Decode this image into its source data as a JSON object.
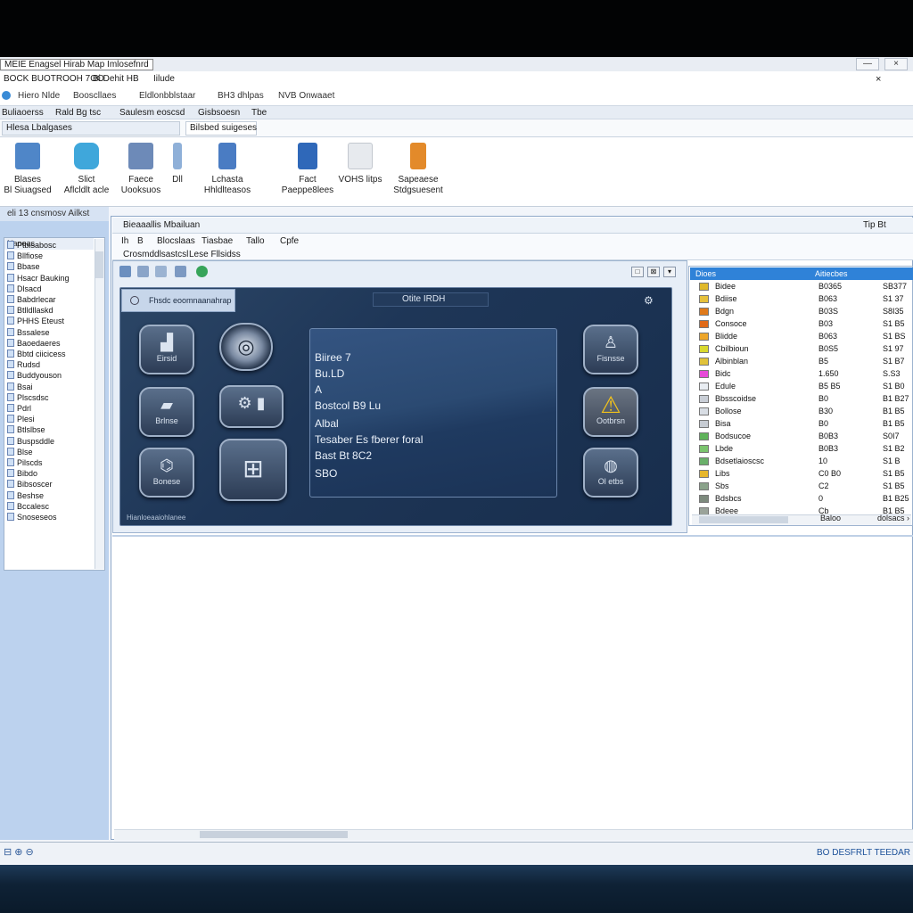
{
  "window": {
    "title": "MEIE Enagsel Hirab Map Imlosefnrd",
    "min": "—",
    "close": "×"
  },
  "menu_row1": [
    "BOCK BUOTROOH 7OO",
    "Bi Dehit HB",
    "Iilude"
  ],
  "menu_row1_right": "×",
  "menu_row2": [
    "Hiero Nlde",
    "Booscllaes",
    "Eldlonbblstaar",
    "BH3 dhlpas",
    "NVB Onwaaet"
  ],
  "menu_row3": [
    "Buliaoerss",
    "Rald Bg tsc",
    "Saulesm eoscsd",
    "Gisbsoesn",
    "Tbe"
  ],
  "ribbon_tabs": [
    "Hlesa Lbalgases",
    "Bilsbed suigeses"
  ],
  "ribbon_buttons": [
    {
      "label1": "Blases",
      "label2": "Bl Siuagsed",
      "icon": "scanner-icon",
      "color": "#4f86c8"
    },
    {
      "label1": "Slict",
      "label2": "Aflcldlt acle",
      "icon": "chat-bubble-icon",
      "color": "#3fa7db"
    },
    {
      "label1": "Faece",
      "label2": "Uooksuos",
      "icon": "device-icon",
      "color": "#6d8ab8"
    },
    {
      "label1": "",
      "label2": "Dll",
      "icon": "small-device-icon",
      "color": "#8fb0d8"
    },
    {
      "label1": "Lchasta",
      "label2": "Hhldlteasos",
      "icon": "phone-icon",
      "color": "#4a7cc3"
    },
    {
      "label1": "Fact",
      "label2": "Paeppe8lees",
      "icon": "person-icon",
      "color": "#2f68b9"
    },
    {
      "label1": "",
      "label2": "VOHS litps",
      "icon": "document-icon",
      "color": "#e7eaee"
    },
    {
      "label1": "Sapeaese",
      "label2": "Stdgsuesent",
      "icon": "lock-icon",
      "color": "#e38a2a"
    }
  ],
  "left_panel": {
    "header": "eli 13 cnsmosv Ailkst",
    "list_header": "Naneas",
    "items": [
      "Ptbisabosc",
      "Bllfiose",
      "Bbase",
      "Hsacr Bauking",
      "Dlsacd",
      "Babdrlecar",
      "Btlldllaskd",
      "PHHS Eteust",
      "Bssalese",
      "Baoedaeres",
      "Bbtd ciicicess",
      "Rudsd",
      "Buddyouson",
      "Bsai",
      "Plscsdsc",
      "Pdrl",
      "Plesi",
      "Btlslbse",
      "Buspsddle",
      "Blse",
      "Pilscds",
      "Bibdo",
      "Bibsoscer",
      "Beshse",
      "Bccalesc",
      "Snoseseos"
    ]
  },
  "main": {
    "title": "Bieaaallis Mbailuan",
    "title_right": "Tip  Bt",
    "menu": [
      "Ih",
      "B",
      "Blocslaas",
      "Tiasbae",
      "Tallo",
      "Cpfe"
    ],
    "sub": [
      "Crosmddlsastcsl",
      "Lese Fllsidss"
    ],
    "ctl": [
      "□",
      "⊠",
      "▾"
    ]
  },
  "dashboard": {
    "label": "Fhsdc eoomnaanahrap",
    "title": "Otite IRDH",
    "gear": "⚙",
    "buttons": [
      {
        "name": "dash-button-chart",
        "glyph": "▟",
        "text": "Eirsid"
      },
      {
        "name": "dash-button-tire",
        "glyph": "◎",
        "text": ""
      },
      {
        "name": "dash-button-folder",
        "glyph": "▰",
        "text": "Brlnse"
      },
      {
        "name": "dash-button-tools",
        "glyph": "⚙ ▮",
        "text": ""
      },
      {
        "name": "dash-button-engine",
        "glyph": "⌬",
        "text": "Bonese"
      },
      {
        "name": "dash-button-seat",
        "glyph": "⊞",
        "text": ""
      },
      {
        "name": "dash-button-person",
        "glyph": "♙",
        "text": "Fisnsse"
      },
      {
        "name": "dash-button-warning",
        "glyph": "⚠",
        "text": "Ootbrsn"
      },
      {
        "name": "dash-button-globe",
        "glyph": "◍",
        "text": "Ol etbs"
      }
    ],
    "screen_lines": [
      "Biiree 7",
      "Bu.LD",
      "A",
      "Bostcol B9 Lu",
      "Albal",
      "Tesaber Es fberer foral",
      "Bast Bt 8C2",
      "SBO"
    ],
    "footer": "Hianloeaaiohlanee"
  },
  "right_panel": {
    "header_left": "Dioes",
    "header_mid": "Aitiecbes",
    "rows": [
      {
        "color": "#e0b92a",
        "name": "Bidee",
        "v1": "B0365",
        "v2": "SB377"
      },
      {
        "color": "#e6c13b",
        "name": "Bdiise",
        "v1": "B063",
        "v2": "S1 37"
      },
      {
        "color": "#e07a1a",
        "name": "Bdgn",
        "v1": "B03S",
        "v2": "S8I35"
      },
      {
        "color": "#e06a18",
        "name": "Consoce",
        "v1": "B03",
        "v2": "S1 B5"
      },
      {
        "color": "#eea62a",
        "name": "Blidde",
        "v1": "B063",
        "v2": "S1 BS"
      },
      {
        "color": "#d9d92e",
        "name": "Cbilbioun",
        "v1": "B0S5",
        "v2": "S1 97"
      },
      {
        "color": "#e0c23a",
        "name": "Albinblan",
        "v1": "B5",
        "v2": "S1 B7"
      },
      {
        "color": "#e74ad8",
        "name": "Bidc",
        "v1": "1.650",
        "v2": "S.S3"
      },
      {
        "color": "#e9edf2",
        "name": "Edule",
        "v1": "B5 B5",
        "v2": "S1 B0"
      },
      {
        "color": "#c9ced6",
        "name": "Bbsscoidse",
        "v1": "B0",
        "v2": "B1 B27"
      },
      {
        "color": "#d8dde4",
        "name": "Bollose",
        "v1": "B30",
        "v2": "B1 B5"
      },
      {
        "color": "#c7ccd3",
        "name": "Bisa",
        "v1": "B0",
        "v2": "B1 B5"
      },
      {
        "color": "#5fb35a",
        "name": "Bodsucoe",
        "v1": "B0B3",
        "v2": "S0I7"
      },
      {
        "color": "#7bc46e",
        "name": "Lbde",
        "v1": "B0B3",
        "v2": "S1 B2"
      },
      {
        "color": "#6ab06a",
        "name": "Bdsetlaioscsc",
        "v1": "10",
        "v2": "S1 B"
      },
      {
        "color": "#e6b62a",
        "name": "Libs",
        "v1": "C0 B0",
        "v2": "S1 B5"
      },
      {
        "color": "#8aa28a",
        "name": "Sbs",
        "v1": "C2",
        "v2": "S1 B5"
      },
      {
        "color": "#7d8a7d",
        "name": "Bdsbcs",
        "v1": "0",
        "v2": "B1 B25"
      },
      {
        "color": "#9aa39a",
        "name": "Bdeee",
        "v1": "Cb",
        "v2": "B1 B5"
      }
    ],
    "scroll_mid": "Baloo",
    "scroll_right": "dolsacs ›"
  },
  "status": {
    "icons": "⊟ ⊕ ⊖",
    "text": "BO DESFRLT TEEDAR"
  }
}
